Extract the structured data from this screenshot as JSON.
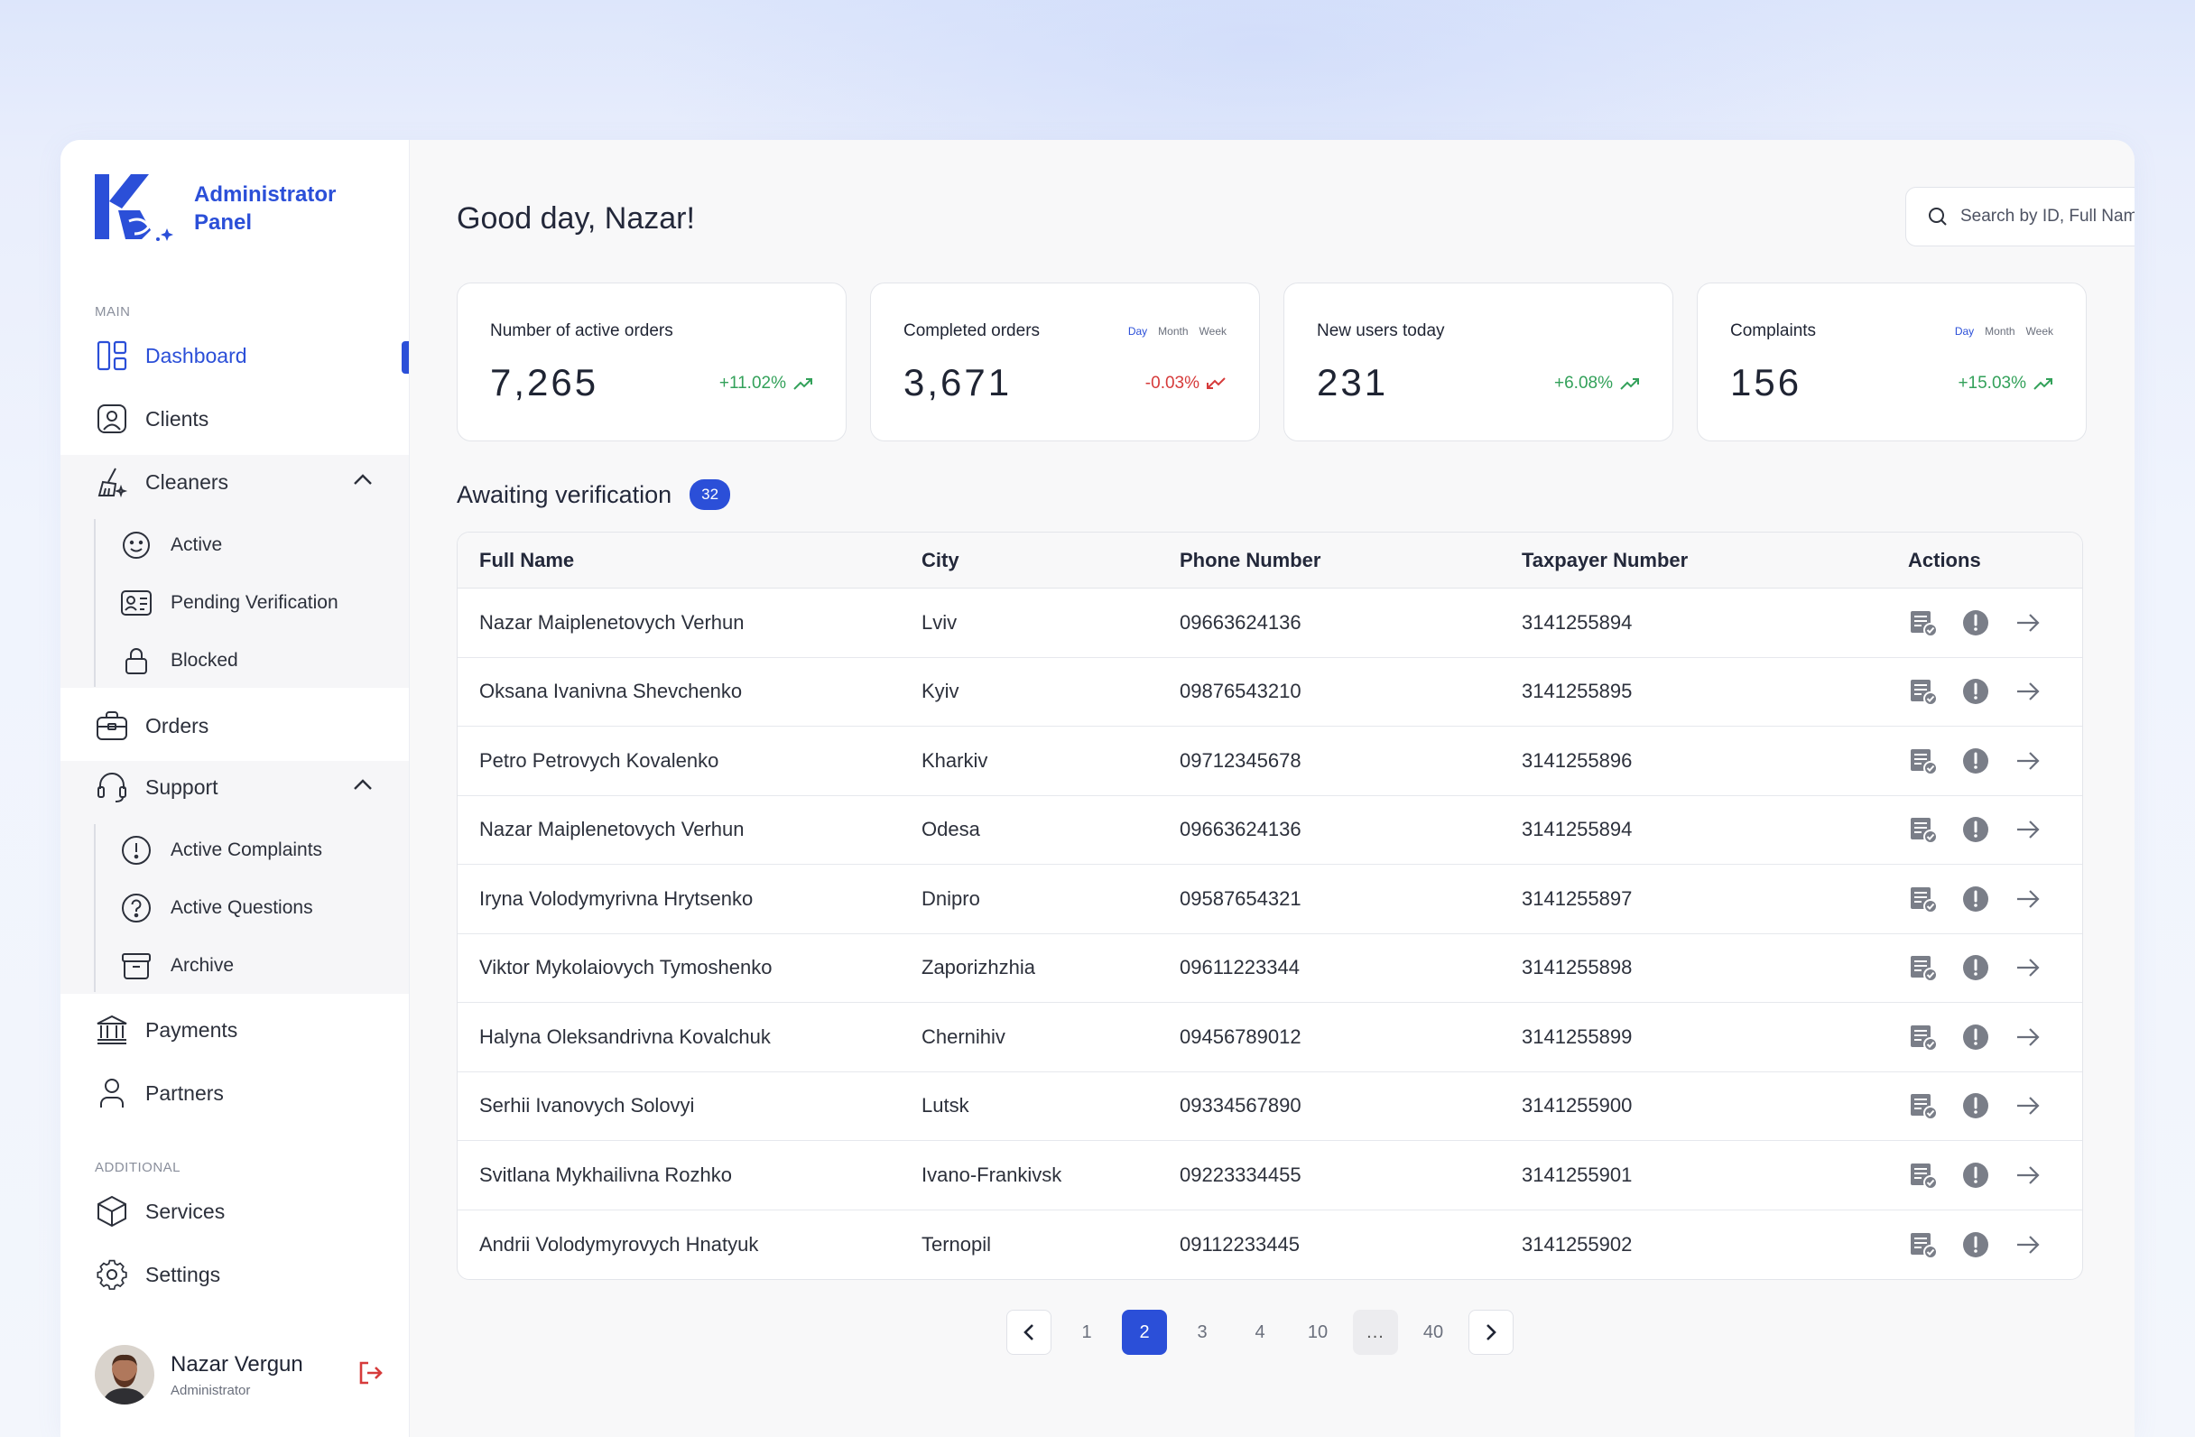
{
  "sidebar": {
    "brand": {
      "line1": "Administrator",
      "line2": "Panel"
    },
    "main_label": "MAIN",
    "additional_label": "ADDITIONAL",
    "items": {
      "dashboard": "Dashboard",
      "clients": "Clients",
      "cleaners": "Cleaners",
      "cleaners_active": "Active",
      "cleaners_pending": "Pending Verification",
      "cleaners_blocked": "Blocked",
      "orders": "Orders",
      "support": "Support",
      "support_complaints": "Active Complaints",
      "support_questions": "Active Questions",
      "support_archive": "Archive",
      "payments": "Payments",
      "partners": "Partners",
      "services": "Services",
      "settings": "Settings"
    },
    "user": {
      "name": "Nazar Vergun",
      "role": "Administrator"
    }
  },
  "header": {
    "greeting": "Good day, Nazar!",
    "search_placeholder": "Search by ID, Full Name, and Email"
  },
  "stats": [
    {
      "label": "Number of active orders",
      "value": "7,265",
      "change": "+11.02%",
      "trend": "up",
      "periods": []
    },
    {
      "label": "Completed orders",
      "value": "3,671",
      "change": "-0.03%",
      "trend": "down",
      "periods": [
        "Day",
        "Month",
        "Week"
      ]
    },
    {
      "label": "New users today",
      "value": "231",
      "change": "+6.08%",
      "trend": "up",
      "periods": []
    },
    {
      "label": "Complaints",
      "value": "156",
      "change": "+15.03%",
      "trend": "up",
      "periods": [
        "Day",
        "Month",
        "Week"
      ]
    }
  ],
  "verification": {
    "title": "Awaiting verification",
    "count": "32",
    "columns": [
      "Full Name",
      "City",
      "Phone Number",
      "Taxpayer Number",
      "Actions"
    ],
    "rows": [
      [
        "Nazar Maiplenetovych Verhun",
        "Lviv",
        "09663624136",
        "3141255894"
      ],
      [
        "Oksana Ivanivna Shevchenko",
        "Kyiv",
        "09876543210",
        "3141255895"
      ],
      [
        "Petro Petrovych Kovalenko",
        "Kharkiv",
        "09712345678",
        "3141255896"
      ],
      [
        "Nazar Maiplenetovych Verhun",
        "Odesa",
        "09663624136",
        "3141255894"
      ],
      [
        "Iryna Volodymyrivna Hrytsenko",
        "Dnipro",
        "09587654321",
        "3141255897"
      ],
      [
        "Viktor Mykolaiovych Tymoshenko",
        "Zaporizhzhia",
        "09611223344",
        "3141255898"
      ],
      [
        "Halyna Oleksandrivna Kovalchuk",
        "Chernihiv",
        "09456789012",
        "3141255899"
      ],
      [
        "Serhii Ivanovych Solovyi",
        "Lutsk",
        "09334567890",
        "3141255900"
      ],
      [
        "Svitlana Mykhailivna Rozhko",
        "Ivano-Frankivsk",
        "09223334455",
        "3141255901"
      ],
      [
        "Andrii Volodymyrovych Hnatyuk",
        "Ternopil",
        "09112233445",
        "3141255902"
      ]
    ]
  },
  "pagination": {
    "pages": [
      "1",
      "2",
      "3",
      "4",
      "10",
      "...",
      "40"
    ],
    "current": "2"
  },
  "colors": {
    "accent": "#2b4fd8",
    "positive": "#33a15a",
    "negative": "#d63b3b"
  }
}
